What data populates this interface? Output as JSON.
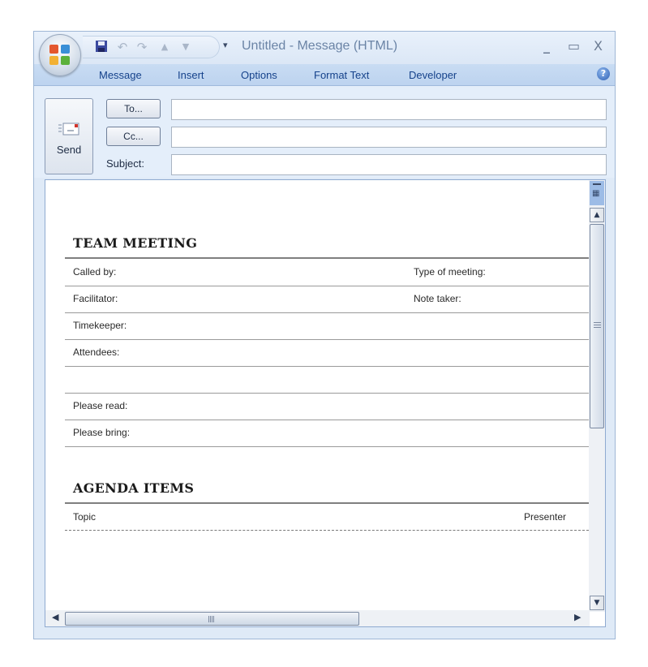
{
  "window": {
    "title": "Untitled - Message (HTML)",
    "controls": {
      "minimize": "_",
      "maximize": "▭",
      "close": "X"
    }
  },
  "quick_access": {
    "save_icon": "save-icon",
    "undo_icon": "↶",
    "redo_icon": "↷",
    "prev_icon": "▲",
    "next_icon": "▼",
    "customize": "▾"
  },
  "ribbon": {
    "tabs": [
      "Message",
      "Insert",
      "Options",
      "Format Text",
      "Developer"
    ],
    "help": "?"
  },
  "compose": {
    "send_label": "Send",
    "to_button": "To...",
    "cc_button": "Cc...",
    "subject_label": "Subject:",
    "to_value": "",
    "cc_value": "",
    "subject_value": ""
  },
  "document": {
    "team_meeting": {
      "heading": "TEAM MEETING",
      "rows": [
        {
          "label": "Called by:",
          "right_label": "Type of meeting:"
        },
        {
          "label": "Facilitator:",
          "right_label": "Note taker:"
        },
        {
          "label": "Timekeeper:",
          "right_label": ""
        },
        {
          "label": "Attendees:",
          "right_label": ""
        },
        {
          "label": "",
          "right_label": ""
        },
        {
          "label": "Please read:",
          "right_label": ""
        },
        {
          "label": "Please bring:",
          "right_label": ""
        }
      ]
    },
    "agenda": {
      "heading": "AGENDA ITEMS",
      "columns": [
        "Topic",
        "Presenter"
      ]
    }
  },
  "scrollbars": {
    "vertical_up": "▲",
    "vertical_down": "▼",
    "horizontal_left": "◀",
    "horizontal_right": "▶"
  }
}
